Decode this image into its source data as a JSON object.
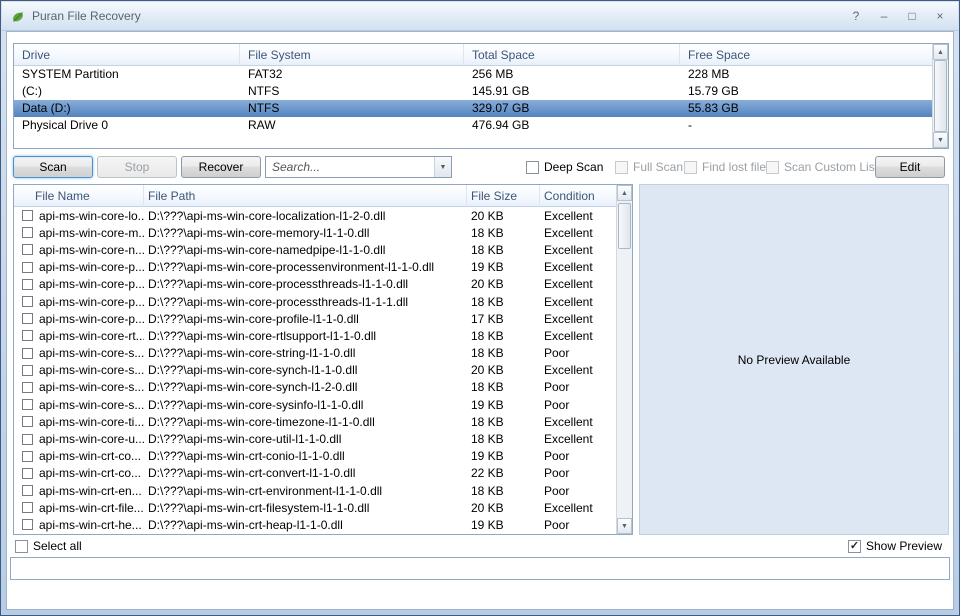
{
  "window": {
    "title": "Puran File Recovery",
    "controls": {
      "help": "?",
      "minimize": "–",
      "maximize": "□",
      "close": "×"
    }
  },
  "colors": {
    "selection_blue": "#5484bf",
    "frame_blue": "#b7cce6",
    "preview_bg": "#dde6f3"
  },
  "drives": {
    "columns": [
      "Drive",
      "File System",
      "Total Space",
      "Free Space"
    ],
    "rows": [
      {
        "drive": "SYSTEM Partition",
        "fs": "FAT32",
        "total": "256 MB",
        "free": "228 MB",
        "selected": false
      },
      {
        "drive": "(C:)",
        "fs": "NTFS",
        "total": "145.91 GB",
        "free": "15.79 GB",
        "selected": false
      },
      {
        "drive": "Data (D:)",
        "fs": "NTFS",
        "total": "329.07 GB",
        "free": "55.83 GB",
        "selected": true
      },
      {
        "drive": "Physical Drive 0",
        "fs": "RAW",
        "total": "476.94 GB",
        "free": "-",
        "selected": false
      }
    ]
  },
  "toolbar": {
    "scan_label": "Scan",
    "stop_label": "Stop",
    "recover_label": "Recover",
    "search_placeholder": "Search...",
    "search_value": "",
    "checkboxes": [
      {
        "label": "Deep Scan",
        "enabled": true,
        "checked": false
      },
      {
        "label": "Full Scan",
        "enabled": false,
        "checked": false
      },
      {
        "label": "Find lost files",
        "enabled": false,
        "checked": false
      },
      {
        "label": "Scan Custom List",
        "enabled": false,
        "checked": false
      }
    ],
    "edit_label": "Edit"
  },
  "files": {
    "columns": [
      "File Name",
      "File Path",
      "File Size",
      "Condition"
    ],
    "rows": [
      {
        "name": "api-ms-win-core-lo...",
        "path": "D:\\???\\api-ms-win-core-localization-l1-2-0.dll",
        "size": "20 KB",
        "condition": "Excellent"
      },
      {
        "name": "api-ms-win-core-m...",
        "path": "D:\\???\\api-ms-win-core-memory-l1-1-0.dll",
        "size": "18 KB",
        "condition": "Excellent"
      },
      {
        "name": "api-ms-win-core-n...",
        "path": "D:\\???\\api-ms-win-core-namedpipe-l1-1-0.dll",
        "size": "18 KB",
        "condition": "Excellent"
      },
      {
        "name": "api-ms-win-core-p...",
        "path": "D:\\???\\api-ms-win-core-processenvironment-l1-1-0.dll",
        "size": "19 KB",
        "condition": "Excellent"
      },
      {
        "name": "api-ms-win-core-p...",
        "path": "D:\\???\\api-ms-win-core-processthreads-l1-1-0.dll",
        "size": "20 KB",
        "condition": "Excellent"
      },
      {
        "name": "api-ms-win-core-p...",
        "path": "D:\\???\\api-ms-win-core-processthreads-l1-1-1.dll",
        "size": "18 KB",
        "condition": "Excellent"
      },
      {
        "name": "api-ms-win-core-p...",
        "path": "D:\\???\\api-ms-win-core-profile-l1-1-0.dll",
        "size": "17 KB",
        "condition": "Excellent"
      },
      {
        "name": "api-ms-win-core-rt...",
        "path": "D:\\???\\api-ms-win-core-rtlsupport-l1-1-0.dll",
        "size": "18 KB",
        "condition": "Excellent"
      },
      {
        "name": "api-ms-win-core-s...",
        "path": "D:\\???\\api-ms-win-core-string-l1-1-0.dll",
        "size": "18 KB",
        "condition": "Poor"
      },
      {
        "name": "api-ms-win-core-s...",
        "path": "D:\\???\\api-ms-win-core-synch-l1-1-0.dll",
        "size": "20 KB",
        "condition": "Excellent"
      },
      {
        "name": "api-ms-win-core-s...",
        "path": "D:\\???\\api-ms-win-core-synch-l1-2-0.dll",
        "size": "18 KB",
        "condition": "Poor"
      },
      {
        "name": "api-ms-win-core-s...",
        "path": "D:\\???\\api-ms-win-core-sysinfo-l1-1-0.dll",
        "size": "19 KB",
        "condition": "Poor"
      },
      {
        "name": "api-ms-win-core-ti...",
        "path": "D:\\???\\api-ms-win-core-timezone-l1-1-0.dll",
        "size": "18 KB",
        "condition": "Excellent"
      },
      {
        "name": "api-ms-win-core-u...",
        "path": "D:\\???\\api-ms-win-core-util-l1-1-0.dll",
        "size": "18 KB",
        "condition": "Excellent"
      },
      {
        "name": "api-ms-win-crt-co...",
        "path": "D:\\???\\api-ms-win-crt-conio-l1-1-0.dll",
        "size": "19 KB",
        "condition": "Poor"
      },
      {
        "name": "api-ms-win-crt-co...",
        "path": "D:\\???\\api-ms-win-crt-convert-l1-1-0.dll",
        "size": "22 KB",
        "condition": "Poor"
      },
      {
        "name": "api-ms-win-crt-en...",
        "path": "D:\\???\\api-ms-win-crt-environment-l1-1-0.dll",
        "size": "18 KB",
        "condition": "Poor"
      },
      {
        "name": "api-ms-win-crt-file...",
        "path": "D:\\???\\api-ms-win-crt-filesystem-l1-1-0.dll",
        "size": "20 KB",
        "condition": "Excellent"
      },
      {
        "name": "api-ms-win-crt-he...",
        "path": "D:\\???\\api-ms-win-crt-heap-l1-1-0.dll",
        "size": "19 KB",
        "condition": "Poor"
      }
    ]
  },
  "preview": {
    "message": "No Preview Available"
  },
  "footer": {
    "select_all_label": "Select all",
    "select_all_checked": false,
    "show_preview_label": "Show Preview",
    "show_preview_checked": true
  },
  "statusbar": {
    "value": ""
  }
}
